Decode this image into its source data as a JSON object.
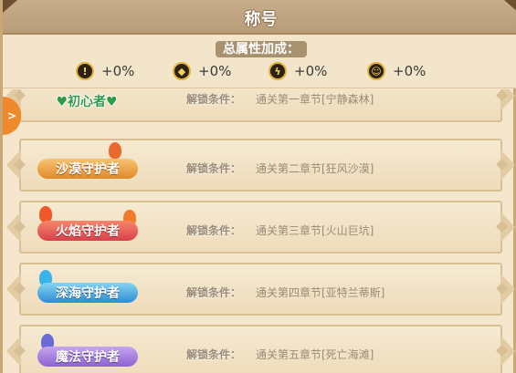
{
  "header": {
    "title": "称号"
  },
  "summary": {
    "label": "总属性加成：",
    "stats": [
      {
        "icon": "attack-icon",
        "glyph": "!",
        "value": "+0%"
      },
      {
        "icon": "defense-icon",
        "glyph": "◆",
        "value": "+0%"
      },
      {
        "icon": "speed-icon",
        "glyph": "ϟ",
        "value": "+0%"
      },
      {
        "icon": "skill-icon",
        "glyph": "☺",
        "value": "+0%"
      }
    ]
  },
  "side_tab": {
    "glyph": ">"
  },
  "titles": [
    {
      "name": "♥初心者♥",
      "condition_label": "解锁条件：",
      "condition": "通关第一章节[宁静森林]"
    },
    {
      "name": "沙漠守护者",
      "condition_label": "解锁条件：",
      "condition": "通关第二章节[狂风沙漠]"
    },
    {
      "name": "火焰守护者",
      "condition_label": "解锁条件：",
      "condition": "通关第三章节[火山巨坑]"
    },
    {
      "name": "深海守护者",
      "condition_label": "解锁条件：",
      "condition": "通关第四章节[亚特兰蒂斯]"
    },
    {
      "name": "魔法守护者",
      "condition_label": "解锁条件：",
      "condition": "通关第五章节[死亡海滩]"
    }
  ]
}
